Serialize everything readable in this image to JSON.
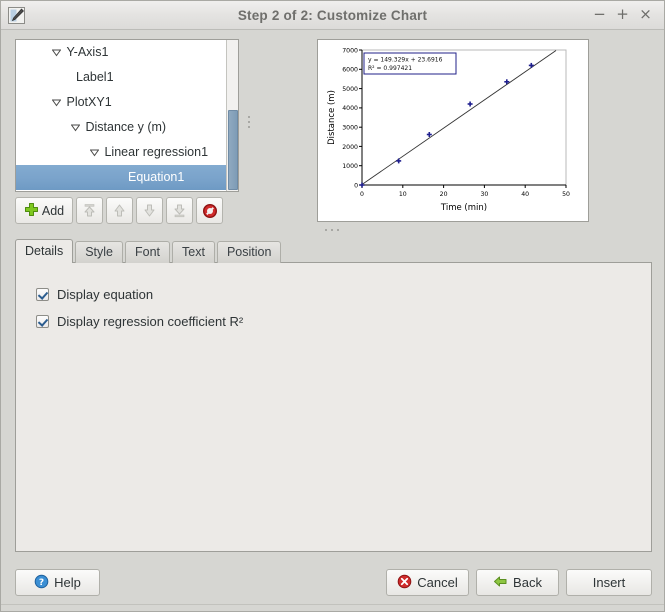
{
  "window": {
    "title": "Step 2 of 2: Customize Chart",
    "icon": "chart-edit-icon",
    "minimize": "−",
    "maximize": "+",
    "close": "×"
  },
  "tree": {
    "items": [
      {
        "label": "Y-Axis1",
        "depth": 1,
        "expander": "expanded",
        "selected": false
      },
      {
        "label": "Label1",
        "depth": 2,
        "expander": "none",
        "selected": false
      },
      {
        "label": "PlotXY1",
        "depth": 1,
        "expander": "expanded",
        "selected": false
      },
      {
        "label": "Distance y (m)",
        "depth": 2,
        "expander": "expanded",
        "selected": false
      },
      {
        "label": "Linear regression1",
        "depth": 3,
        "expander": "expanded",
        "selected": false
      },
      {
        "label": "Equation1",
        "depth": 4,
        "expander": "none",
        "selected": true
      }
    ]
  },
  "toolbar": {
    "add_label": "Add",
    "add_icon": "plus-icon",
    "buttons": [
      {
        "name": "move-to-top-button",
        "icon": "arrow-to-top-icon",
        "enabled": false
      },
      {
        "name": "move-up-button",
        "icon": "arrow-up-icon",
        "enabled": false
      },
      {
        "name": "move-down-button",
        "icon": "arrow-down-icon",
        "enabled": false
      },
      {
        "name": "move-to-bottom-button",
        "icon": "arrow-to-bottom-icon",
        "enabled": false
      },
      {
        "name": "delete-button",
        "icon": "delete-forbidden-icon",
        "enabled": true
      }
    ]
  },
  "tabs": [
    {
      "label": "Details",
      "active": true
    },
    {
      "label": "Style",
      "active": false
    },
    {
      "label": "Font",
      "active": false
    },
    {
      "label": "Text",
      "active": false
    },
    {
      "label": "Position",
      "active": false
    }
  ],
  "details": {
    "display_equation": {
      "label": "Display equation",
      "checked": true
    },
    "display_r2": {
      "label": "Display regression coefficient R²",
      "checked": true
    }
  },
  "footer": {
    "help": "Help",
    "cancel": "Cancel",
    "back": "Back",
    "insert": "Insert",
    "help_icon": "question-mark-icon",
    "cancel_icon": "error-x-icon",
    "back_icon": "arrow-left-icon"
  },
  "colors": {
    "selection_blue": "#7aa3cb",
    "series_marker": "#1f1f8f",
    "regression_line": "#333333",
    "equation_border": "#22228a",
    "window_bg": "#d6d6d2",
    "panel_bg": "#eceae7"
  },
  "chart_data": {
    "type": "scatter",
    "title": "",
    "xlabel": "Time (min)",
    "ylabel": "Distance (m)",
    "xlim": [
      0,
      50
    ],
    "ylim": [
      0,
      7000
    ],
    "xticks": [
      0,
      10,
      20,
      30,
      40,
      50
    ],
    "yticks": [
      0,
      1000,
      2000,
      3000,
      4000,
      5000,
      6000,
      7000
    ],
    "grid": false,
    "legend": false,
    "series": [
      {
        "name": "Distance y (m)",
        "marker": "cross",
        "color": "#1f1f8f",
        "x": [
          0,
          9,
          16.5,
          26.5,
          35.5,
          41.5
        ],
        "y": [
          0,
          1250,
          2620,
          4200,
          5350,
          6200
        ]
      }
    ],
    "trendline": {
      "name": "Linear regression1",
      "type": "linear",
      "slope": 149.329,
      "intercept": 23.6916,
      "r_squared": 0.997421,
      "equation_text": "y = 149.329x + 23.6916",
      "r2_text": "R² = 0.997421"
    }
  }
}
